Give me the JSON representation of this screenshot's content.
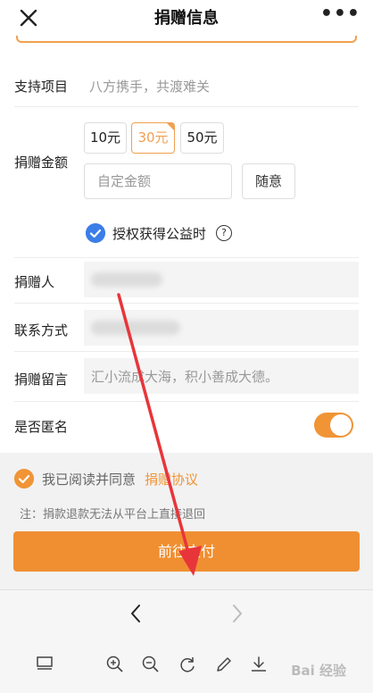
{
  "header": {
    "title": "捐赠信息",
    "more": "•••"
  },
  "form": {
    "project": {
      "label": "支持项目",
      "value": "八方携手，共渡难关"
    },
    "amount": {
      "label": "捐赠金额",
      "options": [
        "10元",
        "30元",
        "50元"
      ],
      "selected": "30元",
      "custom_placeholder": "自定金额",
      "random_label": "随意"
    },
    "authorize": {
      "label": "授权获得公益时",
      "checked": true,
      "help": "?"
    },
    "donor": {
      "label": "捐赠人"
    },
    "contact": {
      "label": "联系方式"
    },
    "message": {
      "label": "捐赠留言",
      "placeholder": "汇小流成大海，积小善成大德。"
    },
    "anonymous": {
      "label": "是否匿名",
      "on": true
    }
  },
  "agreement": {
    "text": "我已阅读并同意",
    "link": "捐赠协议",
    "checked": true
  },
  "note": "注：捐款退款无法从平台上直接退回",
  "pay_button": "前往支付",
  "watermark": "Bai 经验",
  "colors": {
    "accent": "#f08f32",
    "blue_check": "#3b7ee8",
    "arrow": "#e8353a"
  },
  "browser_icons": [
    "back-icon",
    "forward-icon",
    "tabs-icon",
    "zoom-in-icon",
    "zoom-out-icon",
    "refresh-icon",
    "edit-icon",
    "download-icon"
  ]
}
